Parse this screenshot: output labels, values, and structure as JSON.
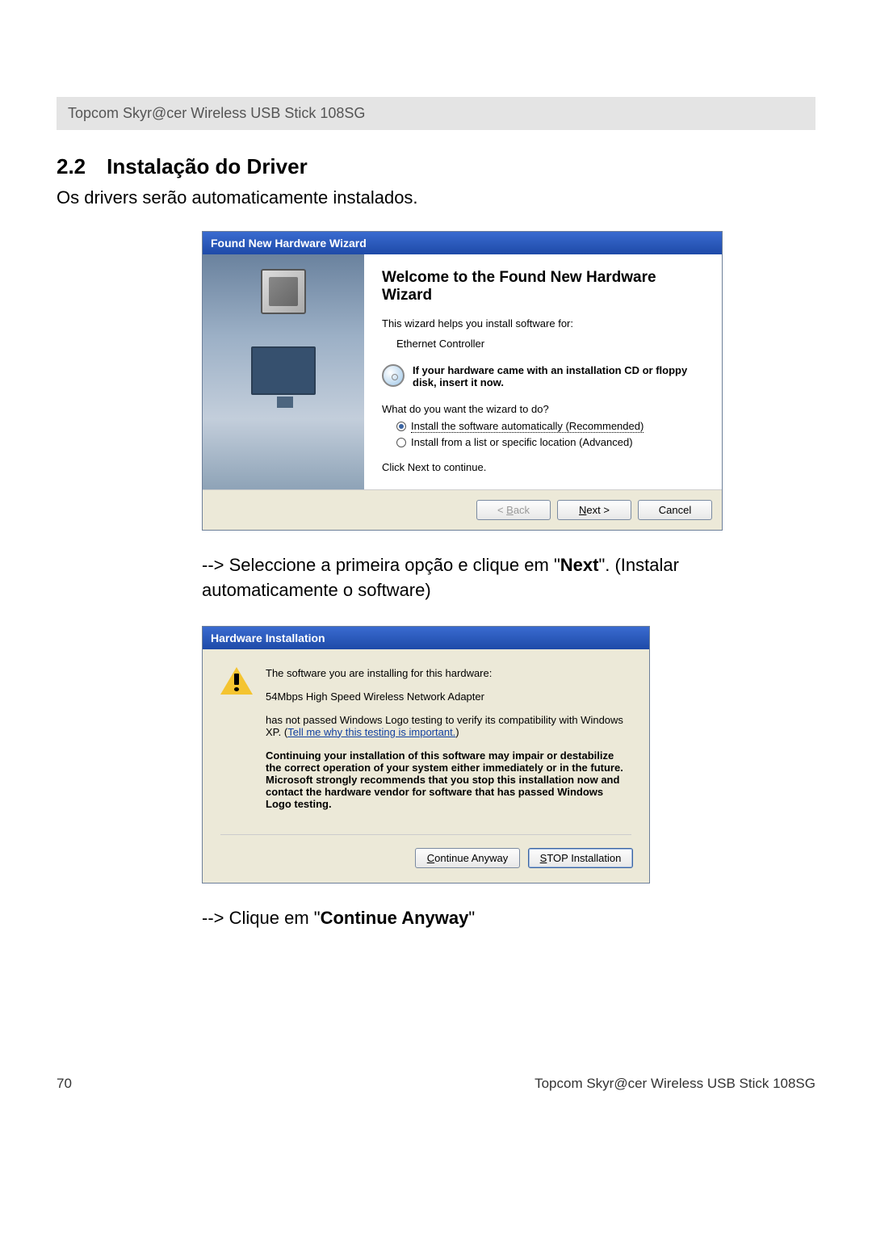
{
  "header": "Topcom Skyr@cer Wireless USB Stick 108SG",
  "section": {
    "number": "2.2",
    "title": "Instalação do Driver"
  },
  "intro": "Os drivers serão automaticamente instalados.",
  "wizard": {
    "title": "Found New Hardware Wizard",
    "heading": "Welcome to the Found New Hardware Wizard",
    "helpLine": "This wizard helps you install software for:",
    "device": "Ethernet Controller",
    "cdText": "If your hardware came with an installation CD or floppy disk, insert it now.",
    "question": "What do you want the wizard to do?",
    "option1": "Install the software automatically (Recommended)",
    "option2": "Install from a list or specific location (Advanced)",
    "clickNext": "Click Next to continue.",
    "backU": "B",
    "backRest": "ack",
    "backPrefix": "< ",
    "nextU": "N",
    "nextRest": "ext >",
    "cancel": "Cancel"
  },
  "instruction1a": "--> Seleccione a primeira opção e clique em  \"",
  "instruction1b": "Next",
  "instruction1c": "\". (Instalar automaticamente o software)",
  "hi": {
    "title": "Hardware Installation",
    "line1": "The software you are installing for this hardware:",
    "line2": "54Mbps High Speed Wireless Network Adapter",
    "line3a": "has not passed Windows Logo testing to verify its compatibility with Windows XP. (",
    "line3link": "Tell me why this testing is important.",
    "line3b": ")",
    "bold": "Continuing your installation of this software may impair or destabilize the correct operation of your system either immediately or in the future. Microsoft strongly recommends that you stop this installation now and contact the hardware vendor for software that has passed Windows Logo testing.",
    "contU": "C",
    "contRest": "ontinue Anyway",
    "stopU": "S",
    "stopRest": "TOP Installation"
  },
  "instruction2a": "--> Clique em \"",
  "instruction2b": "Continue Anyway",
  "instruction2c": "\"",
  "footer": {
    "page": "70",
    "product": "Topcom Skyr@cer Wireless USB Stick 108SG"
  }
}
